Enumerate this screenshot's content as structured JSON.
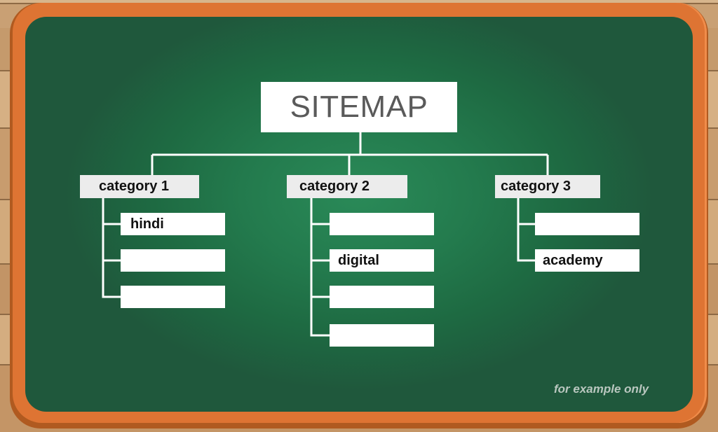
{
  "title": "SITEMAP",
  "categories": [
    {
      "label": "category 1",
      "items": [
        "hindi",
        "",
        ""
      ]
    },
    {
      "label": "category 2",
      "items": [
        "",
        "digital",
        "",
        ""
      ]
    },
    {
      "label": "category 3",
      "items": [
        "",
        "academy"
      ]
    }
  ],
  "footnote": "for example only",
  "colors": {
    "board": "#1f6a42",
    "frame": "#de7433",
    "connector": "#ffffff",
    "title_text": "#5a5a5a"
  }
}
